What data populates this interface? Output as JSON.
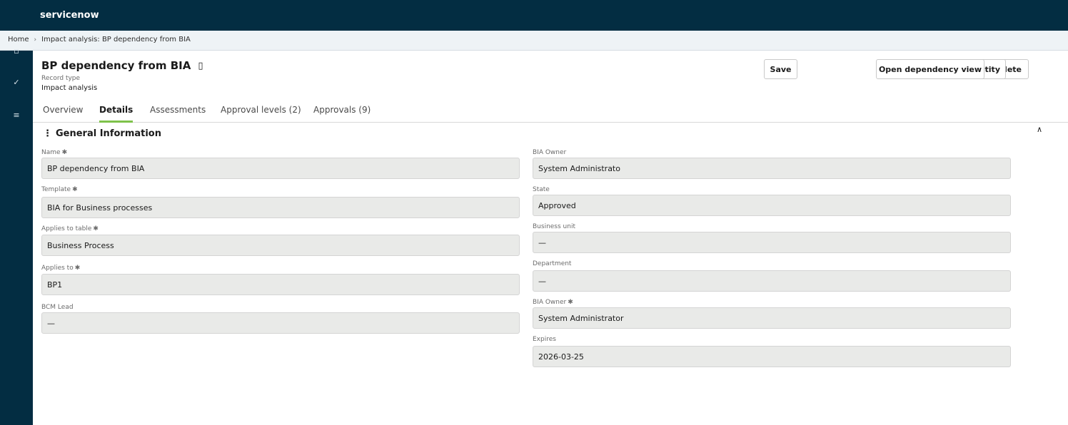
{
  "app": {
    "brand": "servicenow"
  },
  "breadcrumb": {
    "items": [
      "Home",
      "Impact analysis: BP dependency from BIA"
    ],
    "separator": "›"
  },
  "sidebar": {
    "icons": [
      {
        "name": "form-icon",
        "glyph": "▫"
      },
      {
        "name": "checkmark-icon",
        "glyph": "✓"
      },
      {
        "name": "menu-icon",
        "glyph": "≡"
      }
    ]
  },
  "record": {
    "title": "BP dependency from BIA",
    "title_icon": "▯",
    "type_label": "Record type",
    "type_value": "Impact analysis"
  },
  "actions": {
    "save": "Save",
    "dependency_view": "Open dependency view",
    "entity": "tity",
    "delete": "lete"
  },
  "tabs": [
    "Overview",
    "Details",
    "Assessments",
    "Approval levels (2)",
    "Approvals (9)"
  ],
  "active_tab": "Details",
  "section": {
    "title": "General Information",
    "menu_glyph": "⋮",
    "collapse_glyph": "∧"
  },
  "required_marker": "✱",
  "fields_left": [
    {
      "label": "Name",
      "value": "BP dependency from BIA"
    },
    {
      "label": "Template",
      "value": "BIA for Business processes"
    },
    {
      "label": "Applies to table",
      "value": "Business Process"
    },
    {
      "label": "Applies to",
      "value": "BP1"
    },
    {
      "label": "BCM Lead",
      "value": "—"
    }
  ],
  "fields_right": [
    {
      "label": "BIA Owner",
      "value": "System Administrato"
    },
    {
      "label": "State",
      "value": "Approved"
    },
    {
      "label": "Business unit",
      "value": "—"
    },
    {
      "label": "Department",
      "value": "—"
    },
    {
      "label": "BIA Owner",
      "value": "System Administrator"
    },
    {
      "label": "Expires",
      "value": "2026-03-25"
    }
  ],
  "colors": {
    "header_bg": "#032d42",
    "active_tab_accent": "#7ec24a",
    "field_bg": "#e9eae8"
  }
}
